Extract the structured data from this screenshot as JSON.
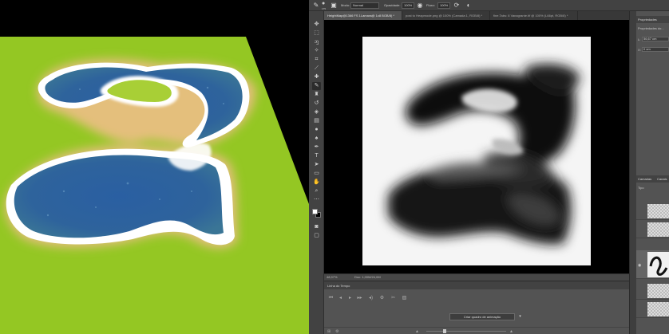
{
  "options_bar": {
    "brush_size": "175",
    "mode_label": "Modo:",
    "mode_value": "Normal",
    "opacity_label": "Opacidade:",
    "opacity_value": "100%",
    "flow_label": "Fluxo:",
    "flow_value": "100%"
  },
  "document_tabs": [
    {
      "label": "HeightMap@1366 FS 1Lamara@ 1c8 BGB/8) *",
      "active": true
    },
    {
      "label": "post to Heapmode.png @ 100% (Camada 1, RGB/8) *",
      "active": false
    },
    {
      "label": "fine.Tabs: 8 Vanagrante.tif @ 100% (L66pt, RGB/8) *",
      "active": false
    }
  ],
  "tools": [
    "move-tool",
    "marquee-tool",
    "lasso-tool",
    "quick-select-tool",
    "crop-tool",
    "eyedropper-tool",
    "healing-tool",
    "brush-tool",
    "stamp-tool",
    "history-brush-tool",
    "eraser-tool",
    "gradient-tool",
    "blur-tool",
    "dodge-tool",
    "pen-tool",
    "type-tool",
    "path-select-tool",
    "shape-tool",
    "hand-tool",
    "zoom-tool",
    "extra-tools"
  ],
  "status_bar": {
    "zoom": "48,97%",
    "doc_info": "Doc: 1,00M/24,0M"
  },
  "timeline": {
    "title": "Linha do Tempo",
    "create_button": "Criar quadro de animação"
  },
  "properties_panel": {
    "title": "Propriedades",
    "subtitle": "Propriedades do...",
    "width_label": "L:",
    "width_value": "56,67 cm",
    "x_label": "X:",
    "x_value": "0 cm"
  },
  "layers_panel": {
    "tab_layers": "Camadas",
    "tab_channels": "Canais",
    "filter_label": "Tipo"
  },
  "colors": {
    "grass": "#8fc420",
    "sand": "#e4bf7c",
    "water": "#27589a",
    "foam": "#ffffff",
    "ps_panel": "#535353",
    "ps_dark": "#424242"
  }
}
